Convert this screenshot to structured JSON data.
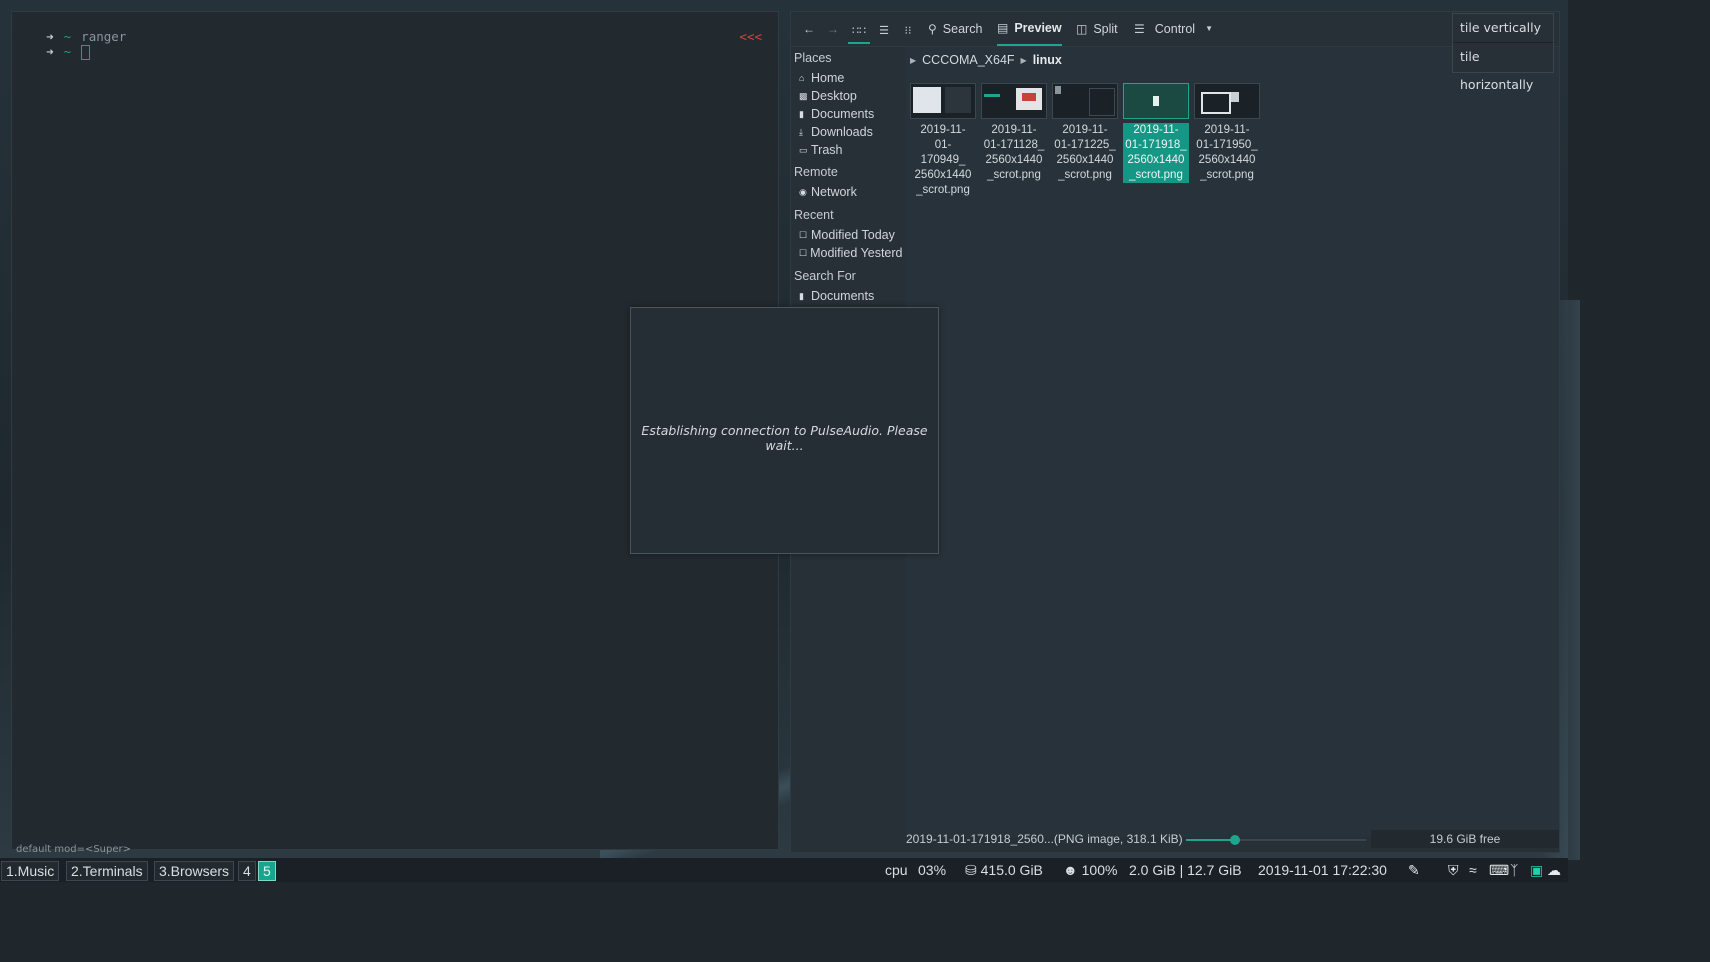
{
  "terminal": {
    "lines": [
      {
        "arrow": "➜",
        "dir": "~",
        "cmd": "ranger"
      },
      {
        "arrow": "➜",
        "dir": "~",
        "cmd": ""
      }
    ],
    "right_prompt": "<<<",
    "footer": "default mod=<Super>"
  },
  "file_manager": {
    "toolbar": {
      "back_icon": "arrow-left-icon",
      "forward_icon": "arrow-right-icon",
      "search_label": "Search",
      "preview_label": "Preview",
      "split_label": "Split",
      "control_label": "Control"
    },
    "sidebar": {
      "places_header": "Places",
      "places": [
        {
          "label": "Home",
          "icon": "home-icon"
        },
        {
          "label": "Desktop",
          "icon": "desktop-icon"
        },
        {
          "label": "Documents",
          "icon": "document-icon"
        },
        {
          "label": "Downloads",
          "icon": "download-icon"
        },
        {
          "label": "Trash",
          "icon": "trash-icon"
        }
      ],
      "remote_header": "Remote",
      "remote": [
        {
          "label": "Network",
          "icon": "network-icon"
        }
      ],
      "recent_header": "Recent",
      "recent": [
        {
          "label": "Modified Today",
          "icon": "calendar-icon"
        },
        {
          "label": "Modified Yesterday",
          "icon": "calendar-icon"
        }
      ],
      "search_header": "Search For",
      "search_for": [
        {
          "label": "Documents",
          "icon": "document-icon"
        }
      ]
    },
    "breadcrumb": {
      "parent": "CCCOMA_X64F",
      "current": "linux"
    },
    "files": [
      {
        "name": "2019-11-01-170949_2560x1440_scrot.png",
        "display": "2019-11-\n01-\n170949_\n2560x1440\n_scrot.png",
        "selected": false
      },
      {
        "name": "2019-11-01-171128_2560x1440_scrot.png",
        "display": "2019-11-\n01-171128_\n2560x1440\n_scrot.png",
        "selected": false
      },
      {
        "name": "2019-11-01-171225_2560x1440_scrot.png",
        "display": "2019-11-\n01-171225_\n2560x1440\n_scrot.png",
        "selected": false
      },
      {
        "name": "2019-11-01-171918_2560x1440_scrot.png",
        "display": "2019-11-\n01-171918_\n2560x1440\n_scrot.png",
        "selected": true
      },
      {
        "name": "2019-11-01-171950_2560x1440_scrot.png",
        "display": "2019-11-\n01-171950_\n2560x1440\n_scrot.png",
        "selected": false
      }
    ],
    "status": {
      "selection": "2019-11-01-171918_2560...(PNG image, 318.1 KiB)",
      "zoom_fraction": 0.27,
      "free": "19.6 GiB free"
    }
  },
  "tile_menu": {
    "items": [
      "tile vertically",
      "tile horizontally"
    ]
  },
  "dialog": {
    "message": "Establishing connection to PulseAudio. Please wait..."
  },
  "panel": {
    "workspaces": [
      "1.Music",
      "2.Terminals",
      "3.Browsers",
      "4",
      "5"
    ],
    "active_workspace": "5",
    "cpu_label": "cpu",
    "cpu_value": "03%",
    "disk": "415.0 GiB",
    "battery": "100%",
    "memory": "2.0 GiB | 12.7 GiB",
    "datetime": "2019-11-01 17:22:30",
    "tray_icons": [
      "pencil-icon",
      "shield-icon",
      "wifi-icon",
      "keyboard-icon",
      "bluetooth-icon",
      "square-icon",
      "wechat-icon"
    ]
  }
}
